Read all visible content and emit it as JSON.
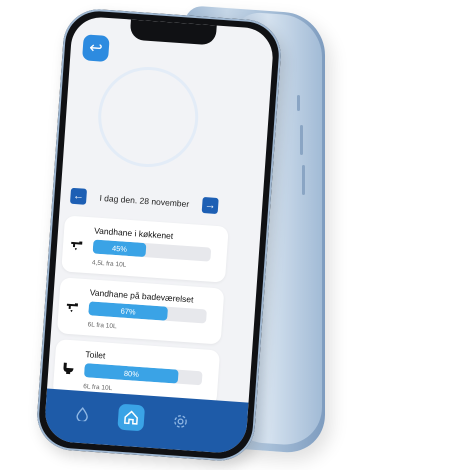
{
  "header": {
    "back_label": "↩"
  },
  "date_nav": {
    "prev_label": "←",
    "next_label": "→",
    "date_text": "I dag den. 28 november"
  },
  "cards": [
    {
      "title": "Vandhane i køkkenet",
      "percent_label": "45%",
      "percent": 45,
      "sub": "4,5L fra 10L",
      "icon": "tap-icon"
    },
    {
      "title": "Vandhane på badeværelset",
      "percent_label": "67%",
      "percent": 67,
      "sub": "6L fra 10L",
      "icon": "tap-icon"
    },
    {
      "title": "Toilet",
      "percent_label": "80%",
      "percent": 80,
      "sub": "6L fra 10L",
      "icon": "toilet-icon"
    }
  ],
  "bottom_nav": {
    "items": [
      "water-drop-icon",
      "home-icon",
      "settings-icon"
    ]
  },
  "colors": {
    "accent": "#3aa3e6",
    "nav": "#1e5ba8",
    "dark_btn": "#1d5fb4"
  }
}
